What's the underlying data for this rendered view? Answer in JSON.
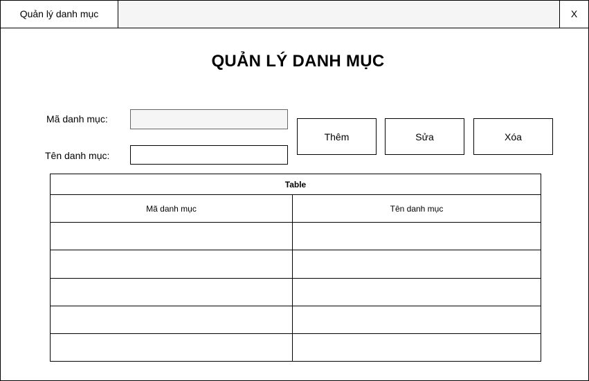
{
  "window": {
    "tab_title": "Quản lý danh mục",
    "close_label": "X"
  },
  "page": {
    "title": "QUẢN LÝ DANH MỤC"
  },
  "form": {
    "code_label": "Mã danh mục:",
    "code_value": "",
    "code_disabled": true,
    "name_label": "Tên danh mục:",
    "name_value": ""
  },
  "actions": {
    "add_label": "Thêm",
    "edit_label": "Sửa",
    "delete_label": "Xóa"
  },
  "table": {
    "caption": "Table",
    "columns": [
      "Mã danh mục",
      "Tên danh mục"
    ],
    "rows": [
      [
        "",
        ""
      ],
      [
        "",
        ""
      ],
      [
        "",
        ""
      ],
      [
        "",
        ""
      ],
      [
        "",
        ""
      ]
    ]
  }
}
